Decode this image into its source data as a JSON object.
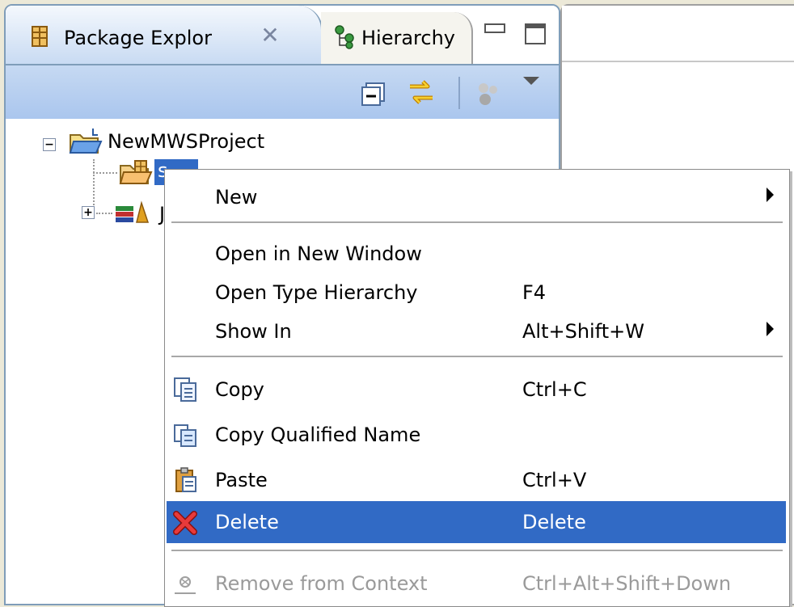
{
  "view": {
    "tabs": [
      {
        "label": "Package Explor",
        "active": true,
        "icon": "package-explorer-icon"
      },
      {
        "label": "Hierarchy",
        "active": false,
        "icon": "hierarchy-icon"
      }
    ]
  },
  "tree": {
    "project": {
      "label": "NewMWSProject",
      "expanded": true
    },
    "children": [
      {
        "label": "s",
        "selected": true,
        "icon": "package-folder-icon"
      },
      {
        "label": "J",
        "selected": false,
        "icon": "library-icon",
        "collapsed": true
      }
    ]
  },
  "menu": {
    "items": [
      {
        "label": "New",
        "accel": "",
        "submenu": true
      },
      {
        "label": "Open in New Window",
        "accel": ""
      },
      {
        "label": "Open Type Hierarchy",
        "accel": "F4"
      },
      {
        "label": "Show In",
        "accel": "Alt+Shift+W",
        "submenu": true
      },
      {
        "label": "Copy",
        "accel": "Ctrl+C",
        "icon": "copy-icon"
      },
      {
        "label": "Copy Qualified Name",
        "accel": "",
        "icon": "copy-qualified-name-icon"
      },
      {
        "label": "Paste",
        "accel": "Ctrl+V",
        "icon": "paste-icon"
      },
      {
        "label": "Delete",
        "accel": "Delete",
        "icon": "delete-icon",
        "highlighted": true
      },
      {
        "label": "Remove from Context",
        "accel": "Ctrl+Alt+Shift+Down",
        "icon": "remove-context-icon",
        "disabled": true
      }
    ]
  },
  "colors": {
    "selection": "#316ac5",
    "view_border": "#7f9db9",
    "toolbar": "#c6d9f2"
  }
}
